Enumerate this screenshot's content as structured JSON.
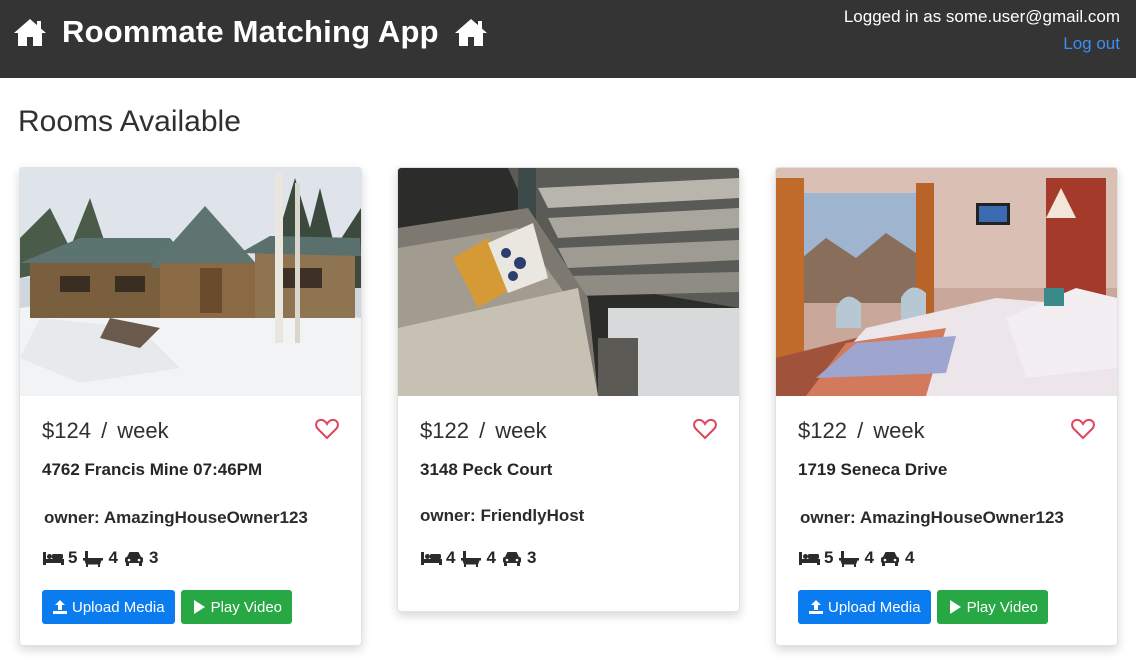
{
  "header": {
    "title": "Roommate Matching App",
    "logged_in_text": "Logged in as some.user@gmail.com",
    "logout_label": "Log out",
    "icon": "home-icon"
  },
  "page": {
    "title": "Rooms Available"
  },
  "colors": {
    "navbar": "#343434",
    "link": "#3b8ef5",
    "heart": "#e0455b",
    "upload_button": "#0b7bf0",
    "play_button": "#27a844"
  },
  "listings": [
    {
      "price": "$124",
      "period": "week",
      "address": "4762 Francis Mine 07:46PM",
      "owner": "owner: AmazingHouseOwner123",
      "beds": "5",
      "baths": "4",
      "parking": "3",
      "upload_label": "Upload Media",
      "play_label": "Play Video",
      "photo": "snowy log cabin"
    },
    {
      "price": "$122",
      "period": "week",
      "address": "3148 Peck Court",
      "owner": "owner: FriendlyHost",
      "beds": "4",
      "baths": "4",
      "parking": "3",
      "photo": "sofa beside staircase"
    },
    {
      "price": "$122",
      "period": "week",
      "address": "1719 Seneca Drive",
      "owner": "owner: AmazingHouseOwner123",
      "beds": "5",
      "baths": "4",
      "parking": "4",
      "upload_label": "Upload Media",
      "play_label": "Play Video",
      "photo": "bedroom with mountain view"
    }
  ]
}
